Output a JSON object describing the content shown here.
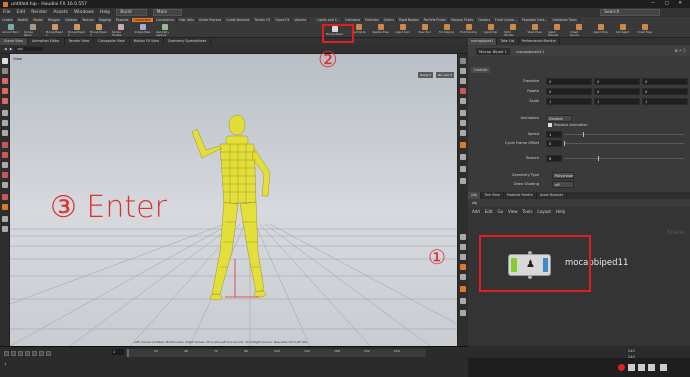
{
  "window": {
    "title": "untitled.hip - Houdini FX 16.0.557"
  },
  "menu": {
    "items": [
      "File",
      "Edit",
      "Render",
      "Assets",
      "Windows",
      "Help"
    ],
    "build_label": "Build",
    "desktop_label": "Main",
    "search_placeholder": "Search"
  },
  "shelf": {
    "tabs": [
      "Create",
      "Modify",
      "Model",
      "Polygon",
      "Deform",
      "Texture",
      "Rigging",
      "Muscles",
      "Characters",
      "Constraints",
      "Hair Utils",
      "Guide Process",
      "Guide Brushes",
      "Terrain FX",
      "Cloud FX",
      "Volume"
    ],
    "active_tab": "Characters",
    "right_tabs": [
      "Lights and C...",
      "Collisions",
      "Particles",
      "Grains",
      "Rigid Bodies",
      "Particle Fluids",
      "Viscous Fluids",
      "Oceans",
      "Fluid Contai...",
      "Populate Cont...",
      "Container Tools",
      "Pyro FX",
      "FEM",
      "Wires",
      "Crowds",
      "Drive Simula..."
    ],
    "tools": [
      "Ground Bind",
      "Simple Biped",
      "Mocap Biped 1",
      "Mocap Biped 2",
      "Mocap Biped 3",
      "Simple Female",
      "Simple Male",
      "Geometry Capture",
      "Auto Rig",
      "Mocap Biped",
      "Electrolyte",
      "Sparkle Pose",
      "Agent Cam",
      "Pose Tool",
      "Fix Clipping",
      "Foot Planting",
      "Agent Clip",
      "Cloth Wrinkle",
      "Stash Pose",
      "Agent Preview",
      "Crowd Source",
      "Agent Prep",
      "Add Agent",
      "Crowd Tags"
    ]
  },
  "viewer": {
    "tabs": [
      "Scene View",
      "Animation Editor",
      "Render View",
      "Composite View",
      "Motion FX View",
      "Geometry Spreadsheet"
    ],
    "active_tab": "Scene View",
    "path": "obj",
    "view_label": "View",
    "persp_label": "Persp ▾",
    "cam_label": "No cam ▾",
    "hint": "Left mouse tumbles. Middle pans. Right dollies. Ctrl+Alt+Left box-zooms. Ctrl+Right zooms. Spacebar-Ctrl-Left tilts."
  },
  "timeline": {
    "current_frame": "1",
    "start_frame": "1",
    "end_frame": "240",
    "end_frame2": "240",
    "ticks": [
      "24",
      "48",
      "72",
      "96",
      "120",
      "144",
      "168",
      "192",
      "216"
    ]
  },
  "params": {
    "tabs": [
      "mocapbiped1",
      "Take List",
      "Performance Monitor"
    ],
    "node_type": "Mocap Biped 1",
    "node_name": "mocapbiped11",
    "section_tab": "Controls",
    "rows": [
      {
        "label": "Translate",
        "values": [
          "0",
          "0",
          "0"
        ]
      },
      {
        "label": "Rotate",
        "values": [
          "0",
          "0",
          "0"
        ]
      },
      {
        "label": "Scale",
        "values": [
          "1",
          "1",
          "1"
        ]
      }
    ],
    "animation_label": "Animation",
    "animation_value": "Zombie",
    "replace_label": "Replace Animation",
    "speed_label": "Speed",
    "speed_value": "1",
    "cycle_label": "Cycle Frame Offset",
    "cycle_value": "0",
    "texture_label": "Texture",
    "texture_value": "6",
    "geotype_label": "Geometry Type",
    "geotype_value": "Polyshape",
    "shading_label": "Draw Shading",
    "shading_value": "off"
  },
  "network": {
    "tabs": [
      "/obj",
      "Tree View",
      "Material Palette",
      "Asset Browser"
    ],
    "path": "obj",
    "menu": [
      "Add",
      "Edit",
      "Go",
      "View",
      "Tools",
      "Layout",
      "Help"
    ],
    "scene_label": "Scene",
    "node_label": "mocapbiped11"
  },
  "annotations": {
    "step1": "①",
    "step2": "②",
    "step3": "③ Enter"
  },
  "colors": {
    "accent": "#e07a26",
    "annotation_red": "#e02020",
    "wireframe": "#e8e020"
  }
}
